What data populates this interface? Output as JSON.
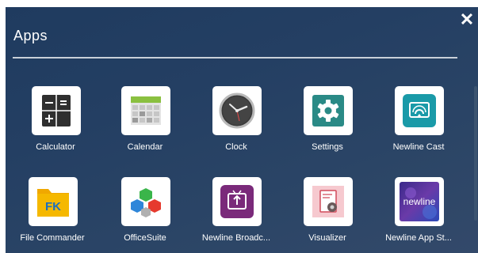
{
  "header": {
    "title": "Apps"
  },
  "close_icon": "close-icon",
  "apps": [
    {
      "label": "Calculator",
      "icon": "calculator-icon"
    },
    {
      "label": "Calendar",
      "icon": "calendar-icon"
    },
    {
      "label": "Clock",
      "icon": "clock-icon"
    },
    {
      "label": "Settings",
      "icon": "settings-gear-icon"
    },
    {
      "label": "Newline Cast",
      "icon": "cast-icon"
    },
    {
      "label": "File Commander",
      "icon": "file-commander-icon"
    },
    {
      "label": "OfficeSuite",
      "icon": "officesuite-icon"
    },
    {
      "label": "Newline Broadc...",
      "icon": "broadcast-icon"
    },
    {
      "label": "Visualizer",
      "icon": "visualizer-icon"
    },
    {
      "label": "Newline App St...",
      "icon": "newline-app-store-icon"
    }
  ],
  "app_store_logo_text": "newline",
  "colors": {
    "background": "#24405f",
    "settings": "#2a8a86",
    "cast": "#1a9aa8",
    "broadcast": "#7a2a7a",
    "file_commander": "#f5b800"
  }
}
